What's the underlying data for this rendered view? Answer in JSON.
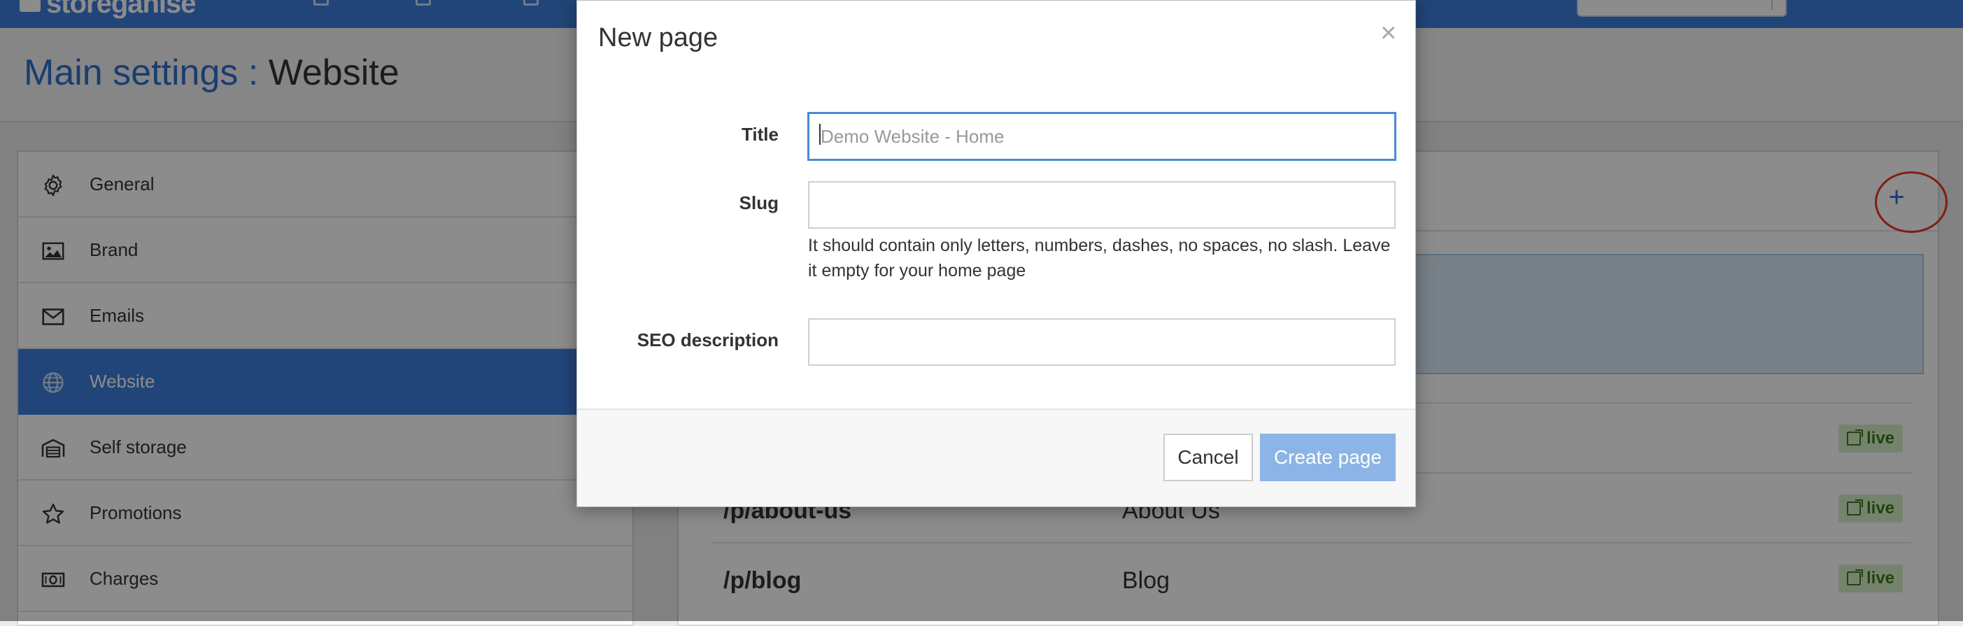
{
  "app": {
    "logo_text": "storeganise"
  },
  "header": {
    "breadcrumb": "Main settings",
    "separator": ":",
    "current": "Website"
  },
  "sidebar": {
    "items": [
      {
        "label": "General",
        "icon": "gear-icon"
      },
      {
        "label": "Brand",
        "icon": "image-icon"
      },
      {
        "label": "Emails",
        "icon": "envelope-icon"
      },
      {
        "label": "Website",
        "icon": "globe-icon",
        "active": true
      },
      {
        "label": "Self storage",
        "icon": "warehouse-icon"
      },
      {
        "label": "Promotions",
        "icon": "star-icon"
      },
      {
        "label": "Charges",
        "icon": "money-icon"
      }
    ]
  },
  "main": {
    "add_label": "+",
    "pages": [
      {
        "slug": "",
        "title": "",
        "status": "live"
      },
      {
        "slug": "/p/about-us",
        "title": "About Us",
        "status": "live"
      },
      {
        "slug": "/p/blog",
        "title": "Blog",
        "status": "live"
      }
    ]
  },
  "modal": {
    "title": "New page",
    "close_label": "×",
    "fields": {
      "title": {
        "label": "Title",
        "placeholder": "Demo Website - Home",
        "value": ""
      },
      "slug": {
        "label": "Slug",
        "value": "",
        "help": "It should contain only letters, numbers, dashes, no spaces, no slash. Leave it empty for your home page"
      },
      "seo": {
        "label": "SEO description",
        "value": ""
      }
    },
    "cancel_label": "Cancel",
    "create_label": "Create page"
  },
  "colors": {
    "brand": "#3c7fdc",
    "live_badge_bg": "#d6efc9",
    "live_badge_text": "#3d7a1c",
    "primary_disabled": "#8cb4e6",
    "highlight": "#e8352a"
  }
}
